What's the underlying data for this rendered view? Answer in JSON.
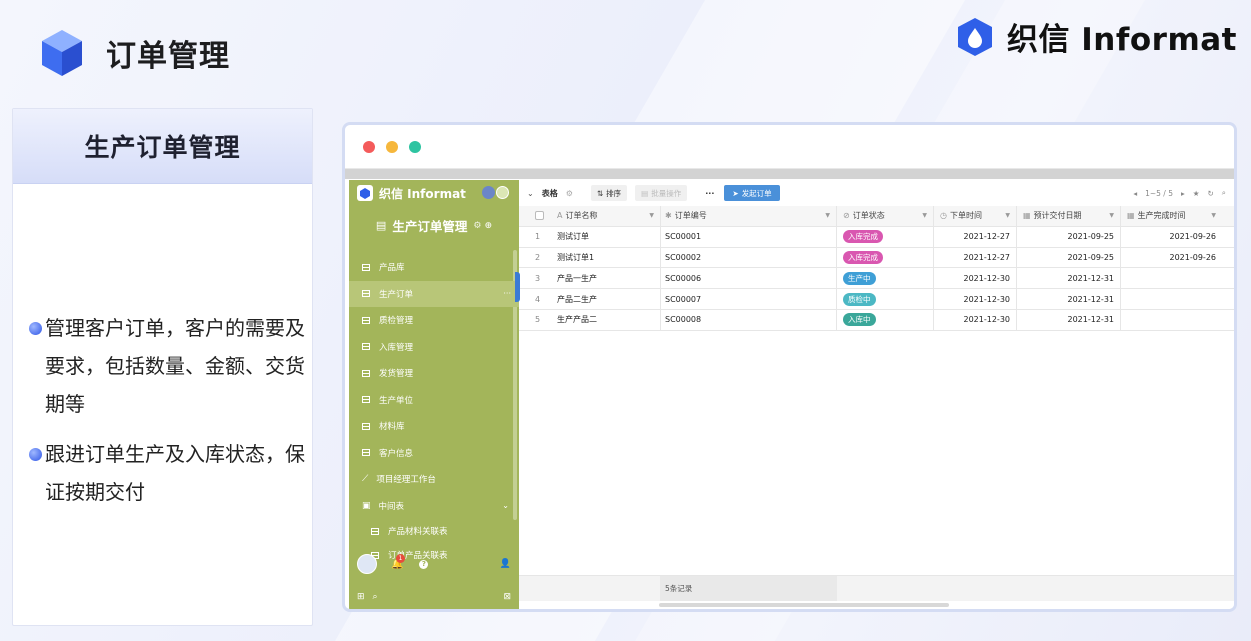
{
  "page": {
    "title": "订单管理",
    "brand_name": "织信 Informat"
  },
  "feature_card": {
    "heading": "生产订单管理",
    "bullets": [
      "管理客户订单，客户的需要及要求，包括数量、金额、交货期等",
      "跟进订单生产及入库状态，保证按期交付"
    ]
  },
  "app": {
    "sidebar": {
      "brand": "织信 Informat",
      "app_name": "生产订单管理",
      "items": [
        {
          "label": "产品库",
          "active": false
        },
        {
          "label": "生产订单",
          "active": true
        },
        {
          "label": "质检管理",
          "active": false
        },
        {
          "label": "入库管理",
          "active": false
        },
        {
          "label": "发货管理",
          "active": false
        },
        {
          "label": "生产单位",
          "active": false
        },
        {
          "label": "材料库",
          "active": false
        },
        {
          "label": "客户信息",
          "active": false
        },
        {
          "label": "项目经理工作台",
          "active": false
        },
        {
          "label": "中间表",
          "active": false
        }
      ],
      "sub_items": [
        "产品材料关联表",
        "订单产品关联表"
      ],
      "notification_count": "1",
      "help_glyph": "?"
    },
    "toolbar": {
      "view_label": "表格",
      "sort_label": "排序",
      "batch_label": "批量操作",
      "more_label": "···",
      "primary_label": "发起订单",
      "pagination": "1~5 / 5"
    },
    "grid": {
      "columns": [
        "订单名称",
        "订单编号",
        "订单状态",
        "下单时间",
        "预计交付日期",
        "生产完成时间"
      ],
      "rows": [
        {
          "n": "1",
          "name": "测试订单",
          "code": "SC00001",
          "status": "入库完成",
          "ordered": "2021-12-27",
          "due": "2021-09-25",
          "done": "2021-09-26"
        },
        {
          "n": "2",
          "name": "测试订单1",
          "code": "SC00002",
          "status": "入库完成",
          "ordered": "2021-12-27",
          "due": "2021-09-25",
          "done": "2021-09-26"
        },
        {
          "n": "3",
          "name": "产品一生产",
          "code": "SC00006",
          "status": "生产中",
          "ordered": "2021-12-30",
          "due": "2021-12-31",
          "done": ""
        },
        {
          "n": "4",
          "name": "产品二生产",
          "code": "SC00007",
          "status": "质检中",
          "ordered": "2021-12-30",
          "due": "2021-12-31",
          "done": ""
        },
        {
          "n": "5",
          "name": "生产产品二",
          "code": "SC00008",
          "status": "入库中",
          "ordered": "2021-12-30",
          "due": "2021-12-31",
          "done": ""
        }
      ],
      "status_colors": {
        "入库完成": "#d957b0",
        "生产中": "#3f9fd6",
        "质检中": "#4cb8c4",
        "入库中": "#3aa79a"
      },
      "record_count": "5条记录"
    }
  },
  "colors": {
    "accent": "#2e55e6",
    "sidebar": "#a3b55a",
    "primary_button": "#4a90d9"
  }
}
